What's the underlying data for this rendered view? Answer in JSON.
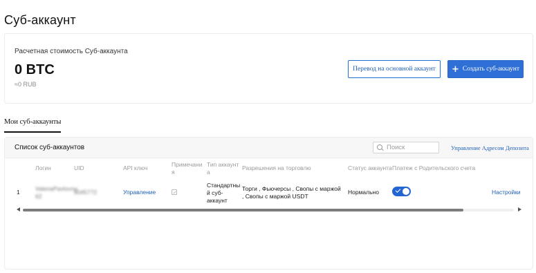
{
  "page": {
    "title": "Суб-аккаунт"
  },
  "summary": {
    "label": "Расчетная стоимость Суб-аккаунта",
    "value": "0 BTC",
    "fiat": "≈0 RUB",
    "transfer_button": "Перевод на основной аккаунт",
    "create_button": "Создать суб-аккаунт",
    "create_icon": "plus-icon"
  },
  "tabs": [
    {
      "label": "Мои суб-аккаунты",
      "active": true
    }
  ],
  "list": {
    "title": "Список суб-аккаунтов",
    "search_placeholder": "Поиск",
    "manage_link": "Управление Адресом Депозита",
    "columns": [
      "Логин",
      "UID",
      "API ключ",
      "Примечани\nя",
      "Тип аккаунт\nа",
      "Разрешения на торговлю",
      "Статус аккаунта",
      "Платеж с Родительского счета"
    ],
    "rows": [
      {
        "index": "1",
        "login": "ValeriaPavlovna\n62",
        "uid": "8045772",
        "api_key": "Управление",
        "type": "Стандартны\nй суб-\nаккаунт",
        "permissions": "Торги , Фьючерсы , Свопы с маржой\n, Свопы с маржой USDT",
        "status": "Нормально",
        "parent_payment": true,
        "settings": "Настройки"
      }
    ]
  },
  "colors": {
    "accent": "#2f6fd6",
    "link": "#1f5fb8"
  }
}
